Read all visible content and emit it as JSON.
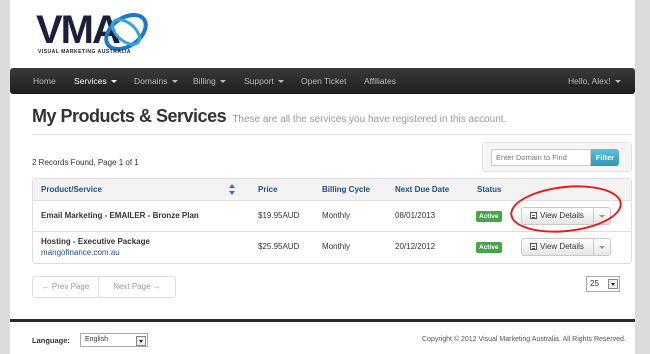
{
  "logo": {
    "text": "VMA",
    "tagline": "VISUAL MARKETING AUSTRALIA"
  },
  "nav": {
    "items": [
      {
        "label": "Home",
        "dropdown": false,
        "active": false
      },
      {
        "label": "Services",
        "dropdown": true,
        "active": true
      },
      {
        "label": "Domains",
        "dropdown": true,
        "active": false
      },
      {
        "label": "Billing",
        "dropdown": true,
        "active": false
      },
      {
        "label": "Support",
        "dropdown": true,
        "active": false
      },
      {
        "label": "Open Ticket",
        "dropdown": false,
        "active": false
      },
      {
        "label": "Affiliates",
        "dropdown": false,
        "active": false
      }
    ],
    "user": "Hello, Alex!"
  },
  "page": {
    "title": "My Products & Services",
    "subtitle": "These are all the services you have registered in this account."
  },
  "records": "2 Records Found, Page 1 of 1",
  "filter": {
    "placeholder": "Enter Domain to Find",
    "button": "Filter"
  },
  "table": {
    "headers": {
      "product": "Product/Service",
      "price": "Price",
      "cycle": "Billing Cycle",
      "due": "Next Due Date",
      "status": "Status"
    },
    "rows": [
      {
        "product": "Email Marketing - EMAILER - Bronze Plan",
        "domain": "",
        "price": "$19.95AUD",
        "cycle": "Monthly",
        "due": "08/01/2013",
        "status": "Active",
        "action": "View Details"
      },
      {
        "product": "Hosting - Executive Package",
        "domain": "mangofinance.com.au",
        "price": "$25.95AUD",
        "cycle": "Monthly",
        "due": "20/12/2012",
        "status": "Active",
        "action": "View Details"
      }
    ]
  },
  "pagination": {
    "prev": "← Prev Page",
    "next": "Next Page →",
    "per_page": "25"
  },
  "footer": {
    "language_label": "Language:",
    "language_value": "English",
    "copyright": "Copyright © 2012 Visual Marketing Australia. All Rights Reserved."
  },
  "colors": {
    "accent": "#1f4e8c",
    "active_badge": "#46a546",
    "filter_button": "#2f96b4",
    "highlight": "#e41b1b"
  }
}
